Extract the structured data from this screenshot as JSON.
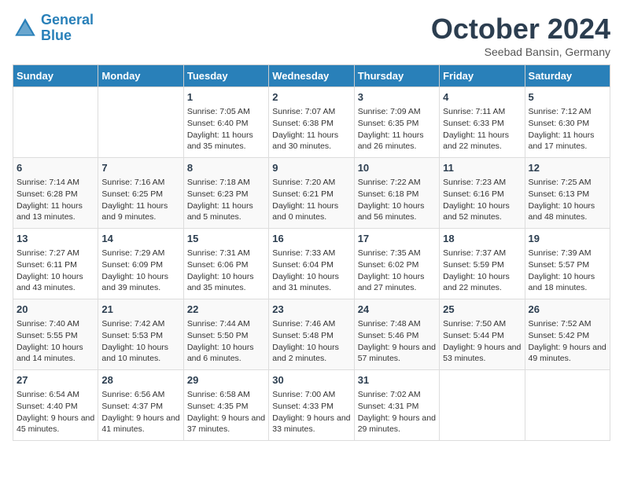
{
  "header": {
    "logo_line1": "General",
    "logo_line2": "Blue",
    "month_title": "October 2024",
    "subtitle": "Seebad Bansin, Germany"
  },
  "weekdays": [
    "Sunday",
    "Monday",
    "Tuesday",
    "Wednesday",
    "Thursday",
    "Friday",
    "Saturday"
  ],
  "weeks": [
    [
      {
        "day": "",
        "info": ""
      },
      {
        "day": "",
        "info": ""
      },
      {
        "day": "1",
        "info": "Sunrise: 7:05 AM\nSunset: 6:40 PM\nDaylight: 11 hours and 35 minutes."
      },
      {
        "day": "2",
        "info": "Sunrise: 7:07 AM\nSunset: 6:38 PM\nDaylight: 11 hours and 30 minutes."
      },
      {
        "day": "3",
        "info": "Sunrise: 7:09 AM\nSunset: 6:35 PM\nDaylight: 11 hours and 26 minutes."
      },
      {
        "day": "4",
        "info": "Sunrise: 7:11 AM\nSunset: 6:33 PM\nDaylight: 11 hours and 22 minutes."
      },
      {
        "day": "5",
        "info": "Sunrise: 7:12 AM\nSunset: 6:30 PM\nDaylight: 11 hours and 17 minutes."
      }
    ],
    [
      {
        "day": "6",
        "info": "Sunrise: 7:14 AM\nSunset: 6:28 PM\nDaylight: 11 hours and 13 minutes."
      },
      {
        "day": "7",
        "info": "Sunrise: 7:16 AM\nSunset: 6:25 PM\nDaylight: 11 hours and 9 minutes."
      },
      {
        "day": "8",
        "info": "Sunrise: 7:18 AM\nSunset: 6:23 PM\nDaylight: 11 hours and 5 minutes."
      },
      {
        "day": "9",
        "info": "Sunrise: 7:20 AM\nSunset: 6:21 PM\nDaylight: 11 hours and 0 minutes."
      },
      {
        "day": "10",
        "info": "Sunrise: 7:22 AM\nSunset: 6:18 PM\nDaylight: 10 hours and 56 minutes."
      },
      {
        "day": "11",
        "info": "Sunrise: 7:23 AM\nSunset: 6:16 PM\nDaylight: 10 hours and 52 minutes."
      },
      {
        "day": "12",
        "info": "Sunrise: 7:25 AM\nSunset: 6:13 PM\nDaylight: 10 hours and 48 minutes."
      }
    ],
    [
      {
        "day": "13",
        "info": "Sunrise: 7:27 AM\nSunset: 6:11 PM\nDaylight: 10 hours and 43 minutes."
      },
      {
        "day": "14",
        "info": "Sunrise: 7:29 AM\nSunset: 6:09 PM\nDaylight: 10 hours and 39 minutes."
      },
      {
        "day": "15",
        "info": "Sunrise: 7:31 AM\nSunset: 6:06 PM\nDaylight: 10 hours and 35 minutes."
      },
      {
        "day": "16",
        "info": "Sunrise: 7:33 AM\nSunset: 6:04 PM\nDaylight: 10 hours and 31 minutes."
      },
      {
        "day": "17",
        "info": "Sunrise: 7:35 AM\nSunset: 6:02 PM\nDaylight: 10 hours and 27 minutes."
      },
      {
        "day": "18",
        "info": "Sunrise: 7:37 AM\nSunset: 5:59 PM\nDaylight: 10 hours and 22 minutes."
      },
      {
        "day": "19",
        "info": "Sunrise: 7:39 AM\nSunset: 5:57 PM\nDaylight: 10 hours and 18 minutes."
      }
    ],
    [
      {
        "day": "20",
        "info": "Sunrise: 7:40 AM\nSunset: 5:55 PM\nDaylight: 10 hours and 14 minutes."
      },
      {
        "day": "21",
        "info": "Sunrise: 7:42 AM\nSunset: 5:53 PM\nDaylight: 10 hours and 10 minutes."
      },
      {
        "day": "22",
        "info": "Sunrise: 7:44 AM\nSunset: 5:50 PM\nDaylight: 10 hours and 6 minutes."
      },
      {
        "day": "23",
        "info": "Sunrise: 7:46 AM\nSunset: 5:48 PM\nDaylight: 10 hours and 2 minutes."
      },
      {
        "day": "24",
        "info": "Sunrise: 7:48 AM\nSunset: 5:46 PM\nDaylight: 9 hours and 57 minutes."
      },
      {
        "day": "25",
        "info": "Sunrise: 7:50 AM\nSunset: 5:44 PM\nDaylight: 9 hours and 53 minutes."
      },
      {
        "day": "26",
        "info": "Sunrise: 7:52 AM\nSunset: 5:42 PM\nDaylight: 9 hours and 49 minutes."
      }
    ],
    [
      {
        "day": "27",
        "info": "Sunrise: 6:54 AM\nSunset: 4:40 PM\nDaylight: 9 hours and 45 minutes."
      },
      {
        "day": "28",
        "info": "Sunrise: 6:56 AM\nSunset: 4:37 PM\nDaylight: 9 hours and 41 minutes."
      },
      {
        "day": "29",
        "info": "Sunrise: 6:58 AM\nSunset: 4:35 PM\nDaylight: 9 hours and 37 minutes."
      },
      {
        "day": "30",
        "info": "Sunrise: 7:00 AM\nSunset: 4:33 PM\nDaylight: 9 hours and 33 minutes."
      },
      {
        "day": "31",
        "info": "Sunrise: 7:02 AM\nSunset: 4:31 PM\nDaylight: 9 hours and 29 minutes."
      },
      {
        "day": "",
        "info": ""
      },
      {
        "day": "",
        "info": ""
      }
    ]
  ]
}
